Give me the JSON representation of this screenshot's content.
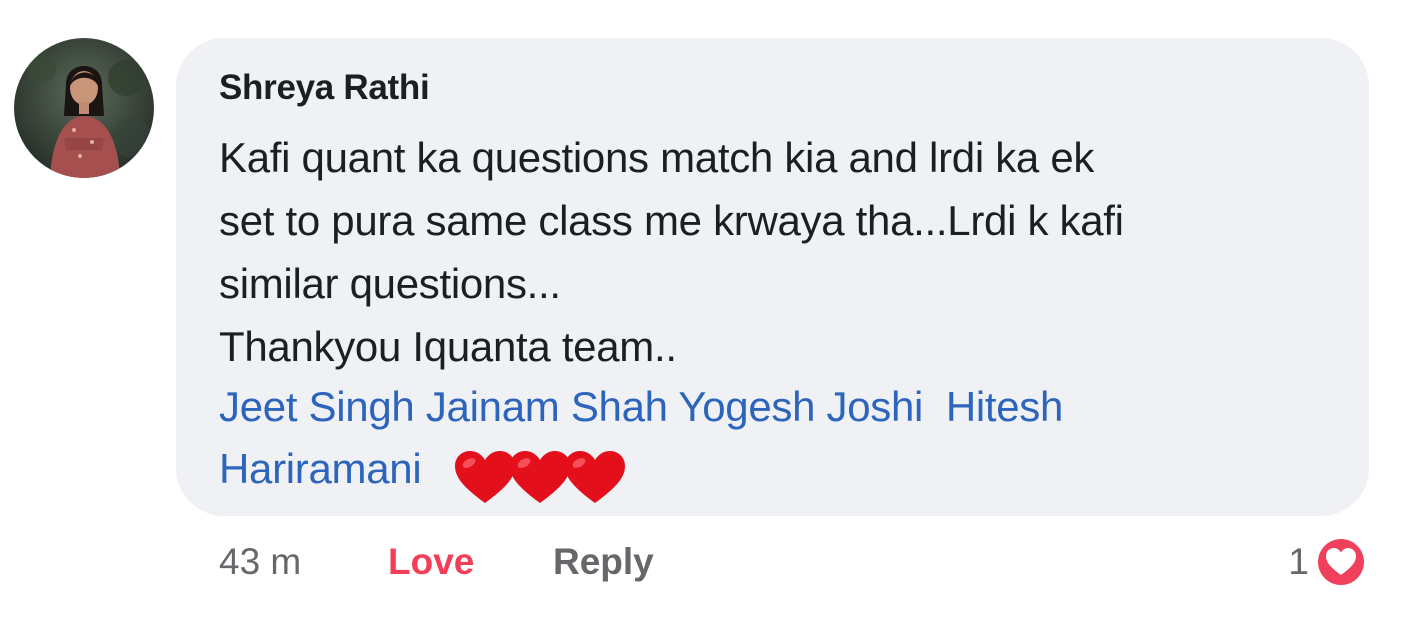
{
  "comment": {
    "author": "Shreya Rathi",
    "body_lines": [
      "Kafi quant ka questions match kia and lrdi ka ek",
      "set to pura same class me krwaya tha...Lrdi k kafi",
      "similar questions...",
      "Thankyou Iquanta team.."
    ],
    "tags": [
      "Jeet Singh",
      "Jainam Shah",
      "Yogesh Joshi",
      "Hitesh",
      "Hariramani"
    ],
    "emoji": "❤❤❤",
    "emoji_icon": "heart-emoji-icon"
  },
  "actions": {
    "time": "43 m",
    "love": "Love",
    "reply": "Reply"
  },
  "reaction": {
    "count": "1",
    "icon": "love-reaction-icon"
  },
  "colors": {
    "bubble": "#eff1f5",
    "tag": "#2d64bc",
    "love": "#f33e58",
    "muted": "#65676b",
    "text": "#1c1e21"
  }
}
